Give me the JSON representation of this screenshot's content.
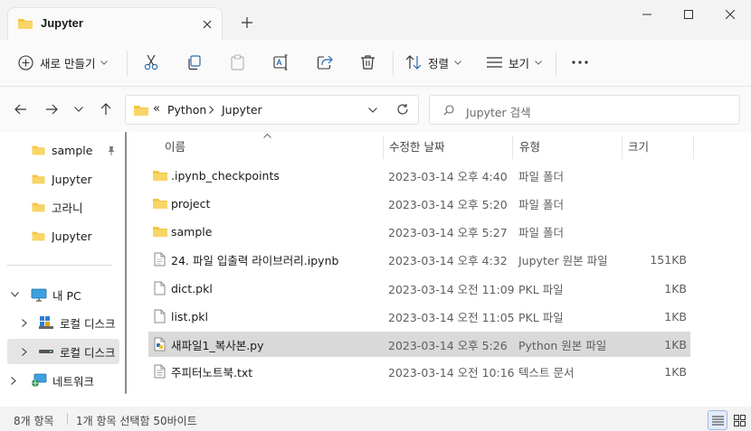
{
  "window": {
    "tab_title": "Jupyter",
    "tab_icon": "folder-icon"
  },
  "toolbar": {
    "new_label": "새로 만들기",
    "sort_label": "정렬",
    "view_label": "보기"
  },
  "address": {
    "overflow": "«",
    "crumbs": [
      "Python",
      "Jupyter"
    ]
  },
  "search": {
    "placeholder": "Jupyter 검색"
  },
  "sidebar": {
    "quick": [
      {
        "label": "sample",
        "pinned": true
      },
      {
        "label": "Jupyter"
      },
      {
        "label": "고라니"
      },
      {
        "label": "Jupyter"
      }
    ],
    "tree": [
      {
        "label": "내 PC",
        "icon": "pc-icon"
      },
      {
        "label": "로컬 디스크",
        "icon": "windows-drive-icon"
      },
      {
        "label": "로컬 디스크",
        "icon": "drive-icon",
        "selected": true
      },
      {
        "label": "네트워크",
        "icon": "network-icon"
      }
    ]
  },
  "columns": {
    "name": "이름",
    "modified": "수정한 날짜",
    "type": "유형",
    "size": "크기"
  },
  "files": [
    {
      "name": ".ipynb_checkpoints",
      "date": "2023-03-14 오후 4:40",
      "type": "파일 폴더",
      "size": "",
      "icon": "folder-icon"
    },
    {
      "name": "project",
      "date": "2023-03-14 오후 5:20",
      "type": "파일 폴더",
      "size": "",
      "icon": "folder-icon"
    },
    {
      "name": "sample",
      "date": "2023-03-14 오후 5:27",
      "type": "파일 폴더",
      "size": "",
      "icon": "folder-icon"
    },
    {
      "name": "24. 파일 입출력 라이브러리.ipynb",
      "date": "2023-03-14 오후 4:32",
      "type": "Jupyter 원본 파일",
      "size": "151KB",
      "icon": "notebook-file-icon"
    },
    {
      "name": "dict.pkl",
      "date": "2023-03-14 오전 11:09",
      "type": "PKL 파일",
      "size": "1KB",
      "icon": "file-icon"
    },
    {
      "name": "list.pkl",
      "date": "2023-03-14 오전 11:05",
      "type": "PKL 파일",
      "size": "1KB",
      "icon": "file-icon"
    },
    {
      "name": "새파일1_복사본.py",
      "date": "2023-03-14 오후 5:26",
      "type": "Python 원본 파일",
      "size": "1KB",
      "icon": "python-file-icon",
      "selected": true
    },
    {
      "name": "주피터노트북.txt",
      "date": "2023-03-14 오전 10:16",
      "type": "텍스트 문서",
      "size": "1KB",
      "icon": "text-file-icon"
    }
  ],
  "status": {
    "count": "8개 항목",
    "selection": "1개 항목 선택함 50바이트"
  },
  "colors": {
    "folder": "#f4c542",
    "selected_row": "#d9d9d9",
    "accent": "#0067c0"
  }
}
